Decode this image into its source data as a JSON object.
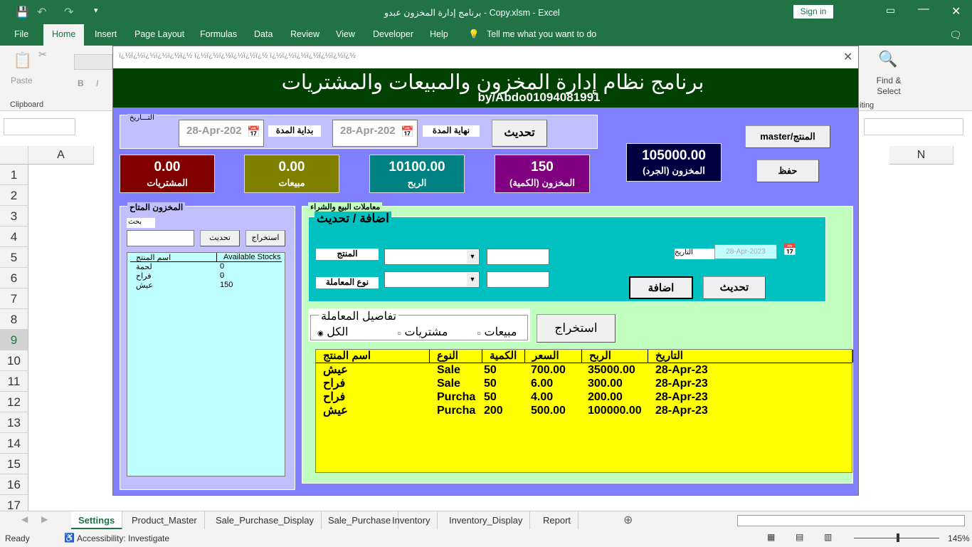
{
  "window": {
    "title": "برنامج إدارة المخزون عبدو - Copy.xlsm  -  Excel",
    "sign_in": "Sign in"
  },
  "menu": [
    "File",
    "Home",
    "Insert",
    "Page Layout",
    "Formulas",
    "Data",
    "Review",
    "View",
    "Developer",
    "Help"
  ],
  "tell_me": "Tell me what you want to do",
  "ribbon": {
    "paste": "Paste",
    "clipboard": "Clipboard",
    "bold": "B",
    "italic": "I",
    "find_select": "Find & Select",
    "editing": "iting"
  },
  "columns": [
    "A",
    "N"
  ],
  "rows": [
    "1",
    "2",
    "3",
    "4",
    "5",
    "6",
    "7",
    "8",
    "9",
    "10",
    "11",
    "12",
    "13",
    "14",
    "15",
    "16",
    "17"
  ],
  "sheet_tabs": [
    "Settings",
    "Product_Master",
    "Sale_Purchase_Display",
    "Sale_Purchase",
    "Inventory",
    "Inventory_Display",
    "Report"
  ],
  "active_tab": "Settings",
  "status": {
    "ready": "Ready",
    "accessibility": "Accessibility: Investigate",
    "zoom": "145%"
  },
  "form": {
    "caption": "ï¿½ï¿½ï¿½ï¿½ï¿½ï¿½ ï¿½ï¿½ï¿½ï¿½ï¿½ï¿½ ï¿½ï¿½ï¿½ï¿½ï¿½ï¿½ï¿½",
    "title": "برنامج نظام إدارة المخزون والمبيعات والمشتريات",
    "subtitle": "by/Abdo01094081991",
    "date_frame": {
      "legend": "التـــاريخ",
      "start_value": "28-Apr-202",
      "start_label": "بداية المدة",
      "end_value": "28-Apr-202",
      "end_label": "نهاية المدة",
      "refresh": "تحديث"
    },
    "cards": [
      {
        "value": "0.00",
        "label": "المشتريات",
        "color": "#800000"
      },
      {
        "value": "0.00",
        "label": "مبيعات",
        "color": "#808000"
      },
      {
        "value": "10100.00",
        "label": "الربح",
        "color": "#008080"
      },
      {
        "value": "150",
        "label": "المخزون (الكمية)",
        "color": "#800080"
      }
    ],
    "inventory_value": {
      "value": "105000.00",
      "label": "المخزون (الجرد)"
    },
    "master_btn": "master/المنتج",
    "save_btn": "حفظ",
    "stock": {
      "legend": "المخزون المتاح",
      "search_label": "بحث",
      "search_value": "",
      "refresh": "تحديث",
      "extract": "استخراج",
      "headers": [
        "اسم المنتج",
        "Available Stocks"
      ],
      "rows": [
        [
          "لحمة",
          "0"
        ],
        [
          "فراح",
          "0"
        ],
        [
          "عيش",
          "150"
        ]
      ]
    },
    "trans": {
      "legend": "معاملات البيع والشراء",
      "add_legend": "اضافة / تحديث",
      "product_label": "المنتج",
      "type_label": "نوع المعاملة",
      "date_label": "التاريخ",
      "date_value": "28-Apr-2023",
      "add_btn": "اضافة",
      "update_btn": "تحديث",
      "details_legend": "تفاصيل المعاملة",
      "opt_all": "الكل",
      "opt_purch": "مشتريات",
      "opt_sales": "مبيعات",
      "selected": "الكل",
      "extract": "استخراج",
      "headers": [
        "اسم المنتج",
        "النوع",
        "الكمية",
        "السعر",
        "الربح",
        "التاريخ"
      ],
      "rows": [
        [
          "عيش",
          "Sale",
          "50",
          "700.00",
          "35000.00",
          "28-Apr-23"
        ],
        [
          "فراح",
          "Sale",
          "50",
          "6.00",
          "300.00",
          "28-Apr-23"
        ],
        [
          "فراح",
          "Purcha",
          "50",
          "4.00",
          "200.00",
          "28-Apr-23"
        ],
        [
          "عيش",
          "Purcha",
          "200",
          "500.00",
          "100000.00",
          "28-Apr-23"
        ]
      ]
    }
  }
}
